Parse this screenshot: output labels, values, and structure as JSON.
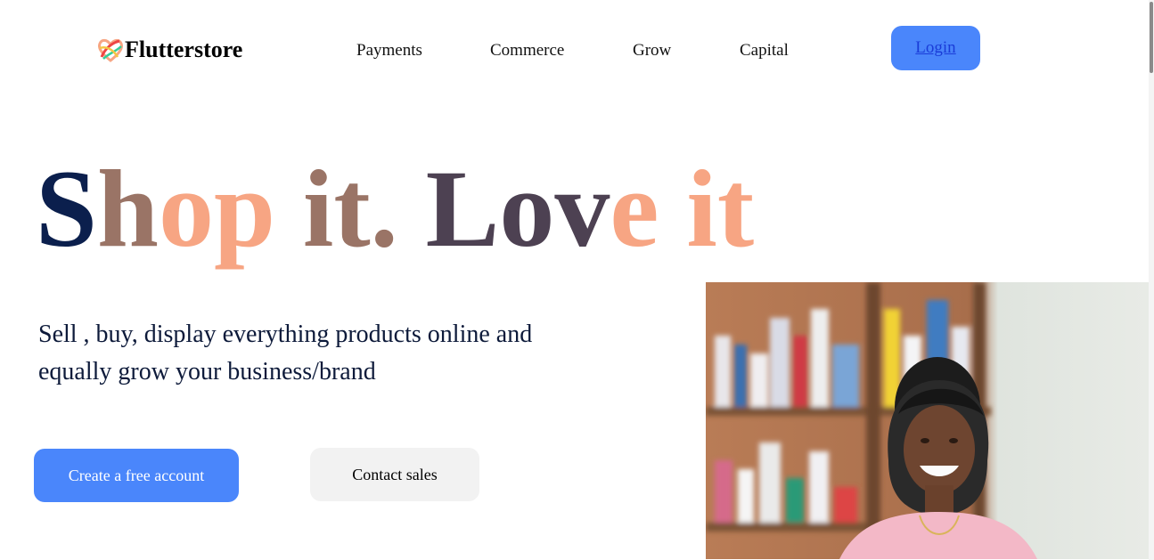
{
  "brand": {
    "name": "Flutterstore",
    "logo_icon": "heart-logo-icon"
  },
  "nav": {
    "items": [
      {
        "label": "Payments"
      },
      {
        "label": "Commerce"
      },
      {
        "label": "Grow"
      },
      {
        "label": "Capital"
      }
    ],
    "login_label": "Login"
  },
  "hero": {
    "headline": {
      "text": "Shop it. Love it",
      "colors": {
        "navy": "#0b1f4d",
        "peach": "#f7a583",
        "mauve": "#9a7466",
        "plum": "#4d4152"
      }
    },
    "subtext": "Sell , buy, display everything products online and equally grow your business/brand",
    "primary_cta": "Create a free account",
    "secondary_cta": "Contact sales",
    "image": "smiling-pharmacist-photo"
  },
  "colors": {
    "accent": "#4a86fb",
    "secondary_button": "#f2f2f2"
  }
}
